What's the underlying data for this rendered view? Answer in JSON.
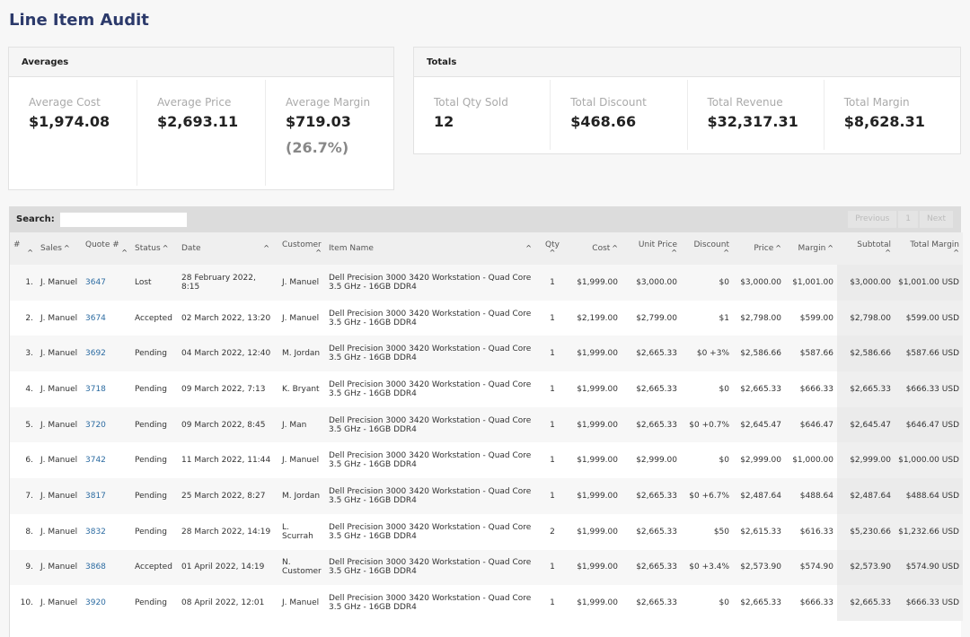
{
  "page": {
    "title": "Line Item Audit"
  },
  "averages": {
    "title": "Averages",
    "items": [
      {
        "label": "Average Cost",
        "value": "$1,974.08"
      },
      {
        "label": "Average Price",
        "value": "$2,693.11"
      },
      {
        "label": "Average Margin",
        "value": "$719.03",
        "sub": "(26.7%)"
      }
    ]
  },
  "totals": {
    "title": "Totals",
    "items": [
      {
        "label": "Total Qty Sold",
        "value": "12"
      },
      {
        "label": "Total Discount",
        "value": "$468.66"
      },
      {
        "label": "Total Revenue",
        "value": "$32,317.31"
      },
      {
        "label": "Total Margin",
        "value": "$8,628.31"
      }
    ]
  },
  "table": {
    "search_label": "Search:",
    "search_value": "",
    "pager": {
      "previous": "Previous",
      "page": "1",
      "next": "Next"
    },
    "columns": [
      "#",
      "Sales",
      "Quote #",
      "Status",
      "Date",
      "Customer",
      "Item Name",
      "Qty",
      "Cost",
      "Unit Price",
      "Discount",
      "Price",
      "Margin",
      "Subtotal",
      "Total Margin"
    ],
    "sort_icon": "caret-up-icon",
    "rows": [
      {
        "n": "1.",
        "sales": "J. Manuel",
        "quote": "3647",
        "status": "Lost",
        "date": "28 February 2022, 8:15",
        "customer": "J. Manuel",
        "item": "Dell Precision 3000 3420 Workstation - Quad Core 3.5 GHz - 16GB DDR4",
        "qty": "1",
        "cost": "$1,999.00",
        "unit_price": "$3,000.00",
        "discount": "$0",
        "price": "$3,000.00",
        "margin": "$1,001.00",
        "subtotal": "$3,000.00",
        "total_margin": "$1,001.00 USD"
      },
      {
        "n": "2.",
        "sales": "J. Manuel",
        "quote": "3674",
        "status": "Accepted",
        "date": "02 March 2022, 13:20",
        "customer": "J. Manuel",
        "item": "Dell Precision 3000 3420 Workstation - Quad Core 3.5 GHz - 16GB DDR4",
        "qty": "1",
        "cost": "$2,199.00",
        "unit_price": "$2,799.00",
        "discount": "$1",
        "price": "$2,798.00",
        "margin": "$599.00",
        "subtotal": "$2,798.00",
        "total_margin": "$599.00 USD"
      },
      {
        "n": "3.",
        "sales": "J. Manuel",
        "quote": "3692",
        "status": "Pending",
        "date": "04 March 2022, 12:40",
        "customer": "M. Jordan",
        "item": "Dell Precision 3000 3420 Workstation - Quad Core 3.5 GHz - 16GB DDR4",
        "qty": "1",
        "cost": "$1,999.00",
        "unit_price": "$2,665.33",
        "discount": "$0 +3%",
        "price": "$2,586.66",
        "margin": "$587.66",
        "subtotal": "$2,586.66",
        "total_margin": "$587.66 USD"
      },
      {
        "n": "4.",
        "sales": "J. Manuel",
        "quote": "3718",
        "status": "Pending",
        "date": "09 March 2022, 7:13",
        "customer": "K. Bryant",
        "item": "Dell Precision 3000 3420 Workstation - Quad Core 3.5 GHz - 16GB DDR4",
        "qty": "1",
        "cost": "$1,999.00",
        "unit_price": "$2,665.33",
        "discount": "$0",
        "price": "$2,665.33",
        "margin": "$666.33",
        "subtotal": "$2,665.33",
        "total_margin": "$666.33 USD"
      },
      {
        "n": "5.",
        "sales": "J. Manuel",
        "quote": "3720",
        "status": "Pending",
        "date": "09 March 2022, 8:45",
        "customer": "J. Man",
        "item": "Dell Precision 3000 3420 Workstation - Quad Core 3.5 GHz - 16GB DDR4",
        "qty": "1",
        "cost": "$1,999.00",
        "unit_price": "$2,665.33",
        "discount": "$0 +0.7%",
        "price": "$2,645.47",
        "margin": "$646.47",
        "subtotal": "$2,645.47",
        "total_margin": "$646.47 USD"
      },
      {
        "n": "6.",
        "sales": "J. Manuel",
        "quote": "3742",
        "status": "Pending",
        "date": "11 March 2022, 11:44",
        "customer": "J. Manuel",
        "item": "Dell Precision 3000 3420 Workstation - Quad Core 3.5 GHz - 16GB DDR4",
        "qty": "1",
        "cost": "$1,999.00",
        "unit_price": "$2,999.00",
        "discount": "$0",
        "price": "$2,999.00",
        "margin": "$1,000.00",
        "subtotal": "$2,999.00",
        "total_margin": "$1,000.00 USD"
      },
      {
        "n": "7.",
        "sales": "J. Manuel",
        "quote": "3817",
        "status": "Pending",
        "date": "25 March 2022, 8:27",
        "customer": "M. Jordan",
        "item": "Dell Precision 3000 3420 Workstation - Quad Core 3.5 GHz - 16GB DDR4",
        "qty": "1",
        "cost": "$1,999.00",
        "unit_price": "$2,665.33",
        "discount": "$0 +6.7%",
        "price": "$2,487.64",
        "margin": "$488.64",
        "subtotal": "$2,487.64",
        "total_margin": "$488.64 USD"
      },
      {
        "n": "8.",
        "sales": "J. Manuel",
        "quote": "3832",
        "status": "Pending",
        "date": "28 March 2022, 14:19",
        "customer": "L. Scurrah",
        "item": "Dell Precision 3000 3420 Workstation - Quad Core 3.5 GHz - 16GB DDR4",
        "qty": "2",
        "cost": "$1,999.00",
        "unit_price": "$2,665.33",
        "discount": "$50",
        "price": "$2,615.33",
        "margin": "$616.33",
        "subtotal": "$5,230.66",
        "total_margin": "$1,232.66 USD"
      },
      {
        "n": "9.",
        "sales": "J. Manuel",
        "quote": "3868",
        "status": "Accepted",
        "date": "01 April 2022, 14:19",
        "customer": "N. Customer",
        "item": "Dell Precision 3000 3420 Workstation - Quad Core 3.5 GHz - 16GB DDR4",
        "qty": "1",
        "cost": "$1,999.00",
        "unit_price": "$2,665.33",
        "discount": "$0 +3.4%",
        "price": "$2,573.90",
        "margin": "$574.90",
        "subtotal": "$2,573.90",
        "total_margin": "$574.90 USD"
      },
      {
        "n": "10.",
        "sales": "J. Manuel",
        "quote": "3920",
        "status": "Pending",
        "date": "08 April 2022, 12:01",
        "customer": "J. Manuel",
        "item": "Dell Precision 3000 3420 Workstation - Quad Core 3.5 GHz - 16GB DDR4",
        "qty": "1",
        "cost": "$1,999.00",
        "unit_price": "$2,665.33",
        "discount": "$0",
        "price": "$2,665.33",
        "margin": "$666.33",
        "subtotal": "$2,665.33",
        "total_margin": "$666.33 USD"
      }
    ]
  },
  "colors": {
    "title": "#2c3a6b",
    "link": "#2d6ca2"
  }
}
